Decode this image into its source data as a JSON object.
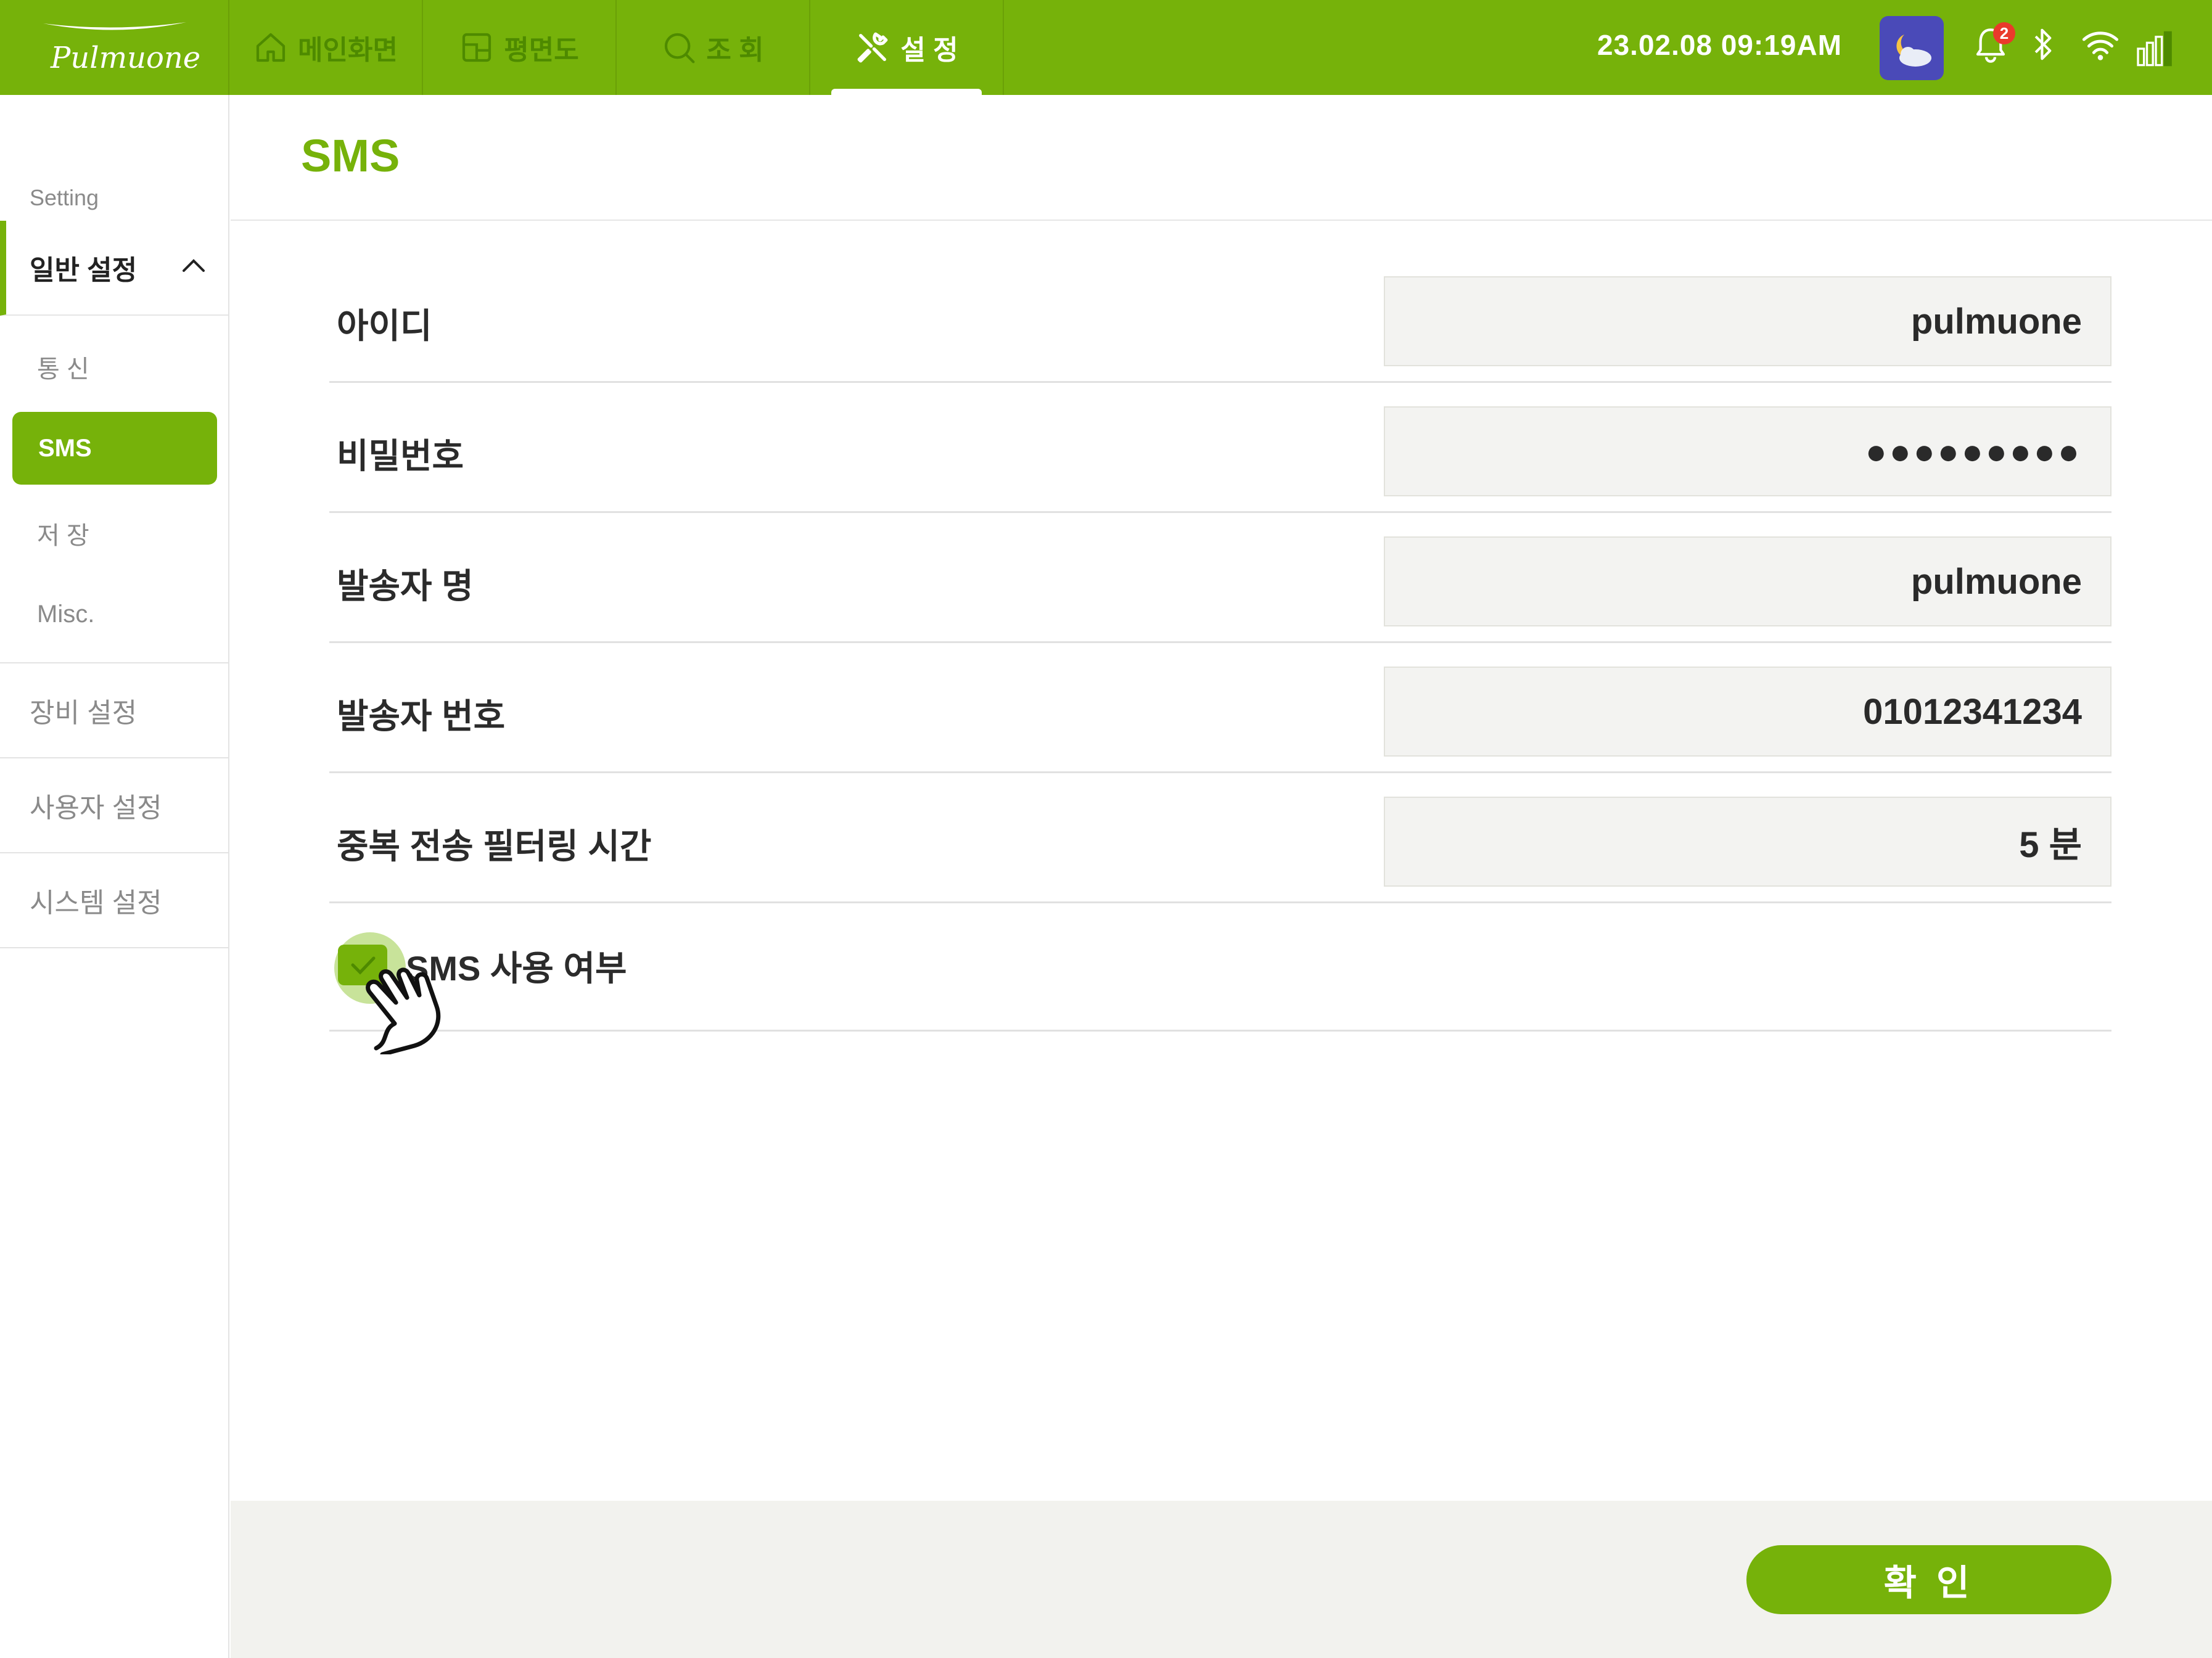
{
  "header": {
    "logo": "Pulmuone",
    "tabs": [
      {
        "label": "메인화면",
        "icon": "home-icon"
      },
      {
        "label": "평면도",
        "icon": "floorplan-icon"
      },
      {
        "label": "조 회",
        "icon": "search-icon"
      },
      {
        "label": "설 정",
        "icon": "tools-icon",
        "active": true
      }
    ],
    "datetime": "23.02.08  09:19AM",
    "notification_count": "2",
    "status_icons": [
      "weather-night-icon",
      "bell-icon",
      "bluetooth-icon",
      "wifi-icon",
      "battery-icon"
    ]
  },
  "sidebar": {
    "caption": "Setting",
    "group": "일반 설정",
    "sub_items": [
      "통 신",
      "SMS",
      "저 장",
      "Misc."
    ],
    "sections": [
      "장비 설정",
      "사용자 설정",
      "시스템 설정"
    ]
  },
  "main": {
    "title": "SMS",
    "rows": [
      {
        "label": "아이디",
        "value": "pulmuone"
      },
      {
        "label": "비밀번호",
        "value": "●●●●●●●●●"
      },
      {
        "label": "발송자 명",
        "value": "pulmuone"
      },
      {
        "label": "발송자 번호",
        "value": "01012341234"
      },
      {
        "label": "중복 전송 필터링 시간",
        "value": "5 분"
      }
    ],
    "sms_enabled": {
      "label": "SMS 사용 여부",
      "checked": true
    }
  },
  "footer": {
    "confirm_label": "확 인"
  },
  "colors": {
    "brand": "#76b20a",
    "brand_dark": "#4e8a00",
    "field_bg": "#f3f3f1",
    "footer_bg": "#f2f2ee"
  }
}
